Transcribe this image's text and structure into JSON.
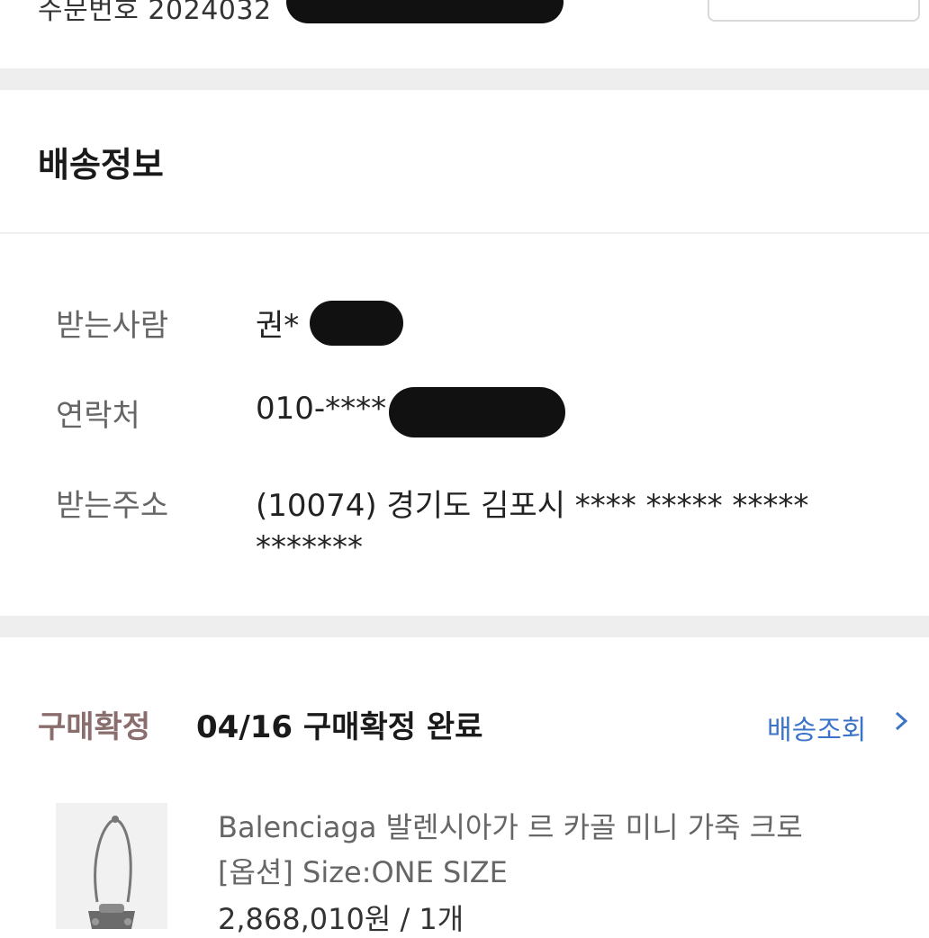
{
  "order": {
    "number_label": "주문번호 2024032"
  },
  "section": {
    "title": "배송정보"
  },
  "shipping": {
    "rows": [
      {
        "label": "받는사람",
        "value": "권*"
      },
      {
        "label": "연락처",
        "value": "010-****"
      },
      {
        "label": "받는주소",
        "value": "(10074) 경기도 김포시 **** ***** *****",
        "value_line2": "*******"
      }
    ]
  },
  "status": {
    "badge": "구매확정",
    "text": "04/16 구매확정 완료",
    "track_label": "배송조회",
    "chevron": "chevron-right-icon"
  },
  "product": {
    "name": "Balenciaga 발렌시아가 르 카골 미니 가죽 크로",
    "option": "[옵션] Size:ONE SIZE",
    "price_qty": "2,868,010원 / 1개"
  },
  "colors": {
    "link": "#3a73c8",
    "badge": "#8a6d6d",
    "divider": "#eeeeee"
  }
}
